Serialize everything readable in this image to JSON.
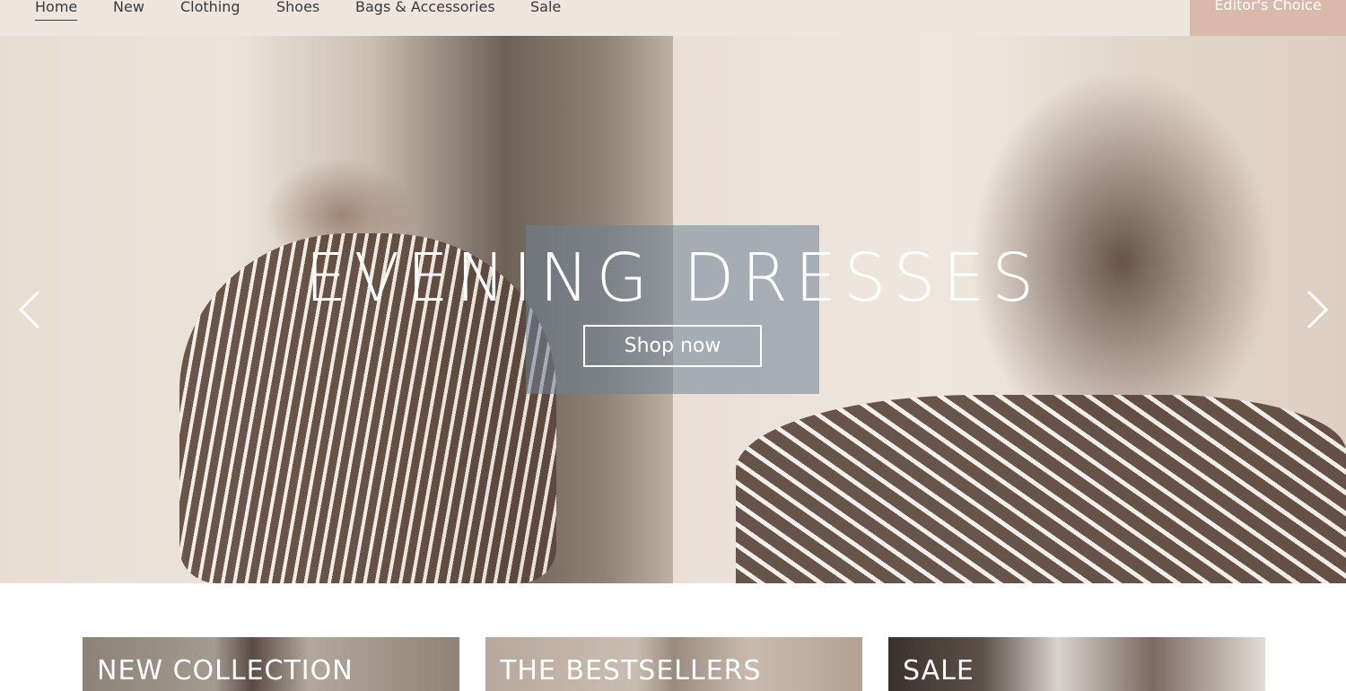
{
  "nav": {
    "items": [
      {
        "label": "Home",
        "active": true
      },
      {
        "label": "New"
      },
      {
        "label": "Clothing"
      },
      {
        "label": "Shoes"
      },
      {
        "label": "Bags & Accessories"
      },
      {
        "label": "Sale"
      }
    ],
    "editors_choice": "Editor's Choice"
  },
  "hero": {
    "title": "EVENING DRESSES",
    "cta": "Shop now"
  },
  "categories": [
    {
      "label": "NEW COLLECTION"
    },
    {
      "label": "THE BESTSELLERS"
    },
    {
      "label": "SALE"
    }
  ],
  "colors": {
    "nav_bg": "#efe5df",
    "accent": "#d9b9ab",
    "text": "#3a3a3a"
  }
}
